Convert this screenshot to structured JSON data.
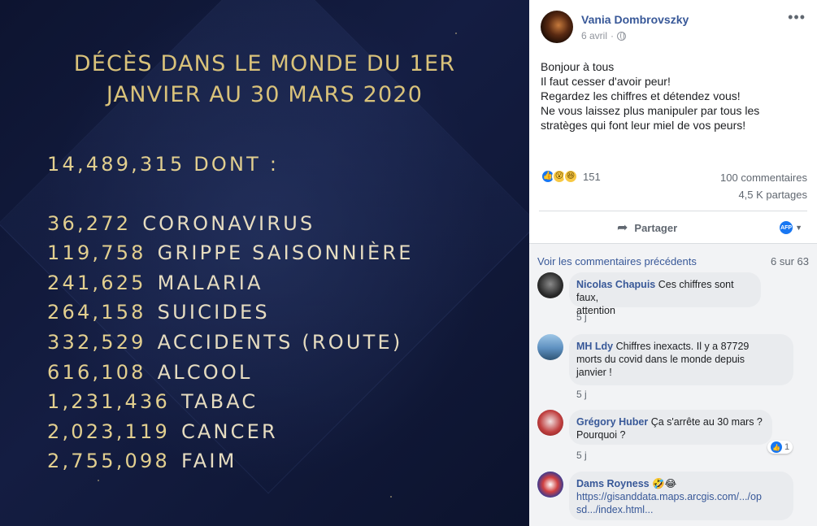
{
  "image": {
    "title_line1": "DÉCÈS DANS LE MONDE DU 1ER",
    "title_line2": "JANVIER AU 30 MARS 2020",
    "total": "14,489,315 DONT :",
    "rows": [
      {
        "value": "36,272",
        "label": "CORONAVIRUS"
      },
      {
        "value": "119,758",
        "label": "GRIPPE SAISONNIÈRE"
      },
      {
        "value": "241,625",
        "label": "MALARIA"
      },
      {
        "value": "264,158",
        "label": "SUICIDES"
      },
      {
        "value": "332,529",
        "label": "ACCIDENTS (ROUTE)"
      },
      {
        "value": "616,108",
        "label": "ALCOOL"
      },
      {
        "value": "1,231,436",
        "label": "TABAC"
      },
      {
        "value": "2,023,119",
        "label": "CANCER"
      },
      {
        "value": "2,755,098",
        "label": "FAIM"
      }
    ]
  },
  "post": {
    "author": "Vania Dombrovszky",
    "date": "6 avril",
    "more_icon": "more-horizontal-icon",
    "text_lines": [
      "Bonjour à tous",
      "Il faut cesser d'avoir peur!",
      "Regardez les chiffres et détendez vous!",
      "Ne vous laissez plus manipuler par tous les",
      "stratèges qui font leur miel de vos peurs!"
    ],
    "reactions_count": "151",
    "comments_count": "100 commentaires",
    "shares_count": "4,5 K partages",
    "share_label": "Partager",
    "audience_badge": "AFP"
  },
  "comments": {
    "view_previous": "Voir les commentaires précédents",
    "count_of": "6 sur 63",
    "items": [
      {
        "name": "Nicolas Chapuis",
        "text_parts": [
          "Ces chiffres sont faux,",
          "attention"
        ],
        "time": "5 j"
      },
      {
        "name": "MH Ldy",
        "text_parts": [
          "Chiffres inexacts. Il y a 87729",
          "morts du covid dans le monde depuis",
          "janvier !"
        ],
        "time": "5 j"
      },
      {
        "name": "Grégory Huber",
        "text_parts": [
          "Ça s'arrête au 30 mars ?",
          "Pourquoi ?"
        ],
        "time": "5 j",
        "reaction_count": "1"
      },
      {
        "name": "Dams Royness",
        "emoji": "🤣😂",
        "link_parts": [
          "https://gisanddata.maps.arcgis.com/.../op",
          "sd.../index.html..."
        ]
      }
    ]
  },
  "colors": {
    "link_blue": "#385898",
    "image_gold": "#e2cf8f",
    "image_bg": "#111a3a"
  }
}
